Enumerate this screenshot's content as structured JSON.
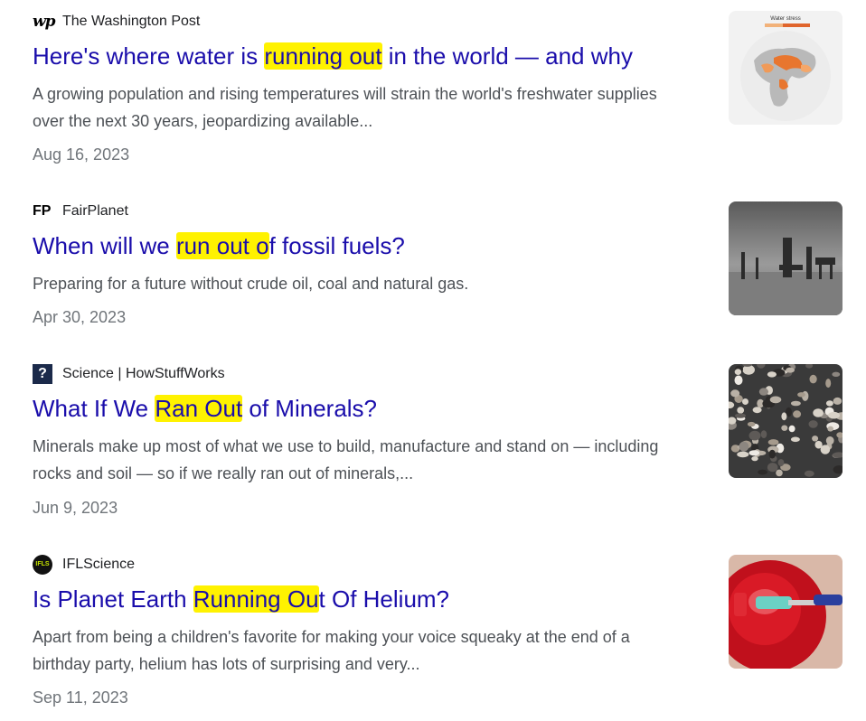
{
  "results": [
    {
      "source": "The Washington Post",
      "icon": "wp-logo-icon",
      "icon_text": "wp",
      "title_before": "Here's where water is ",
      "title_highlight": "running out",
      "title_after": " in the world — and why",
      "snippet_line1": "A growing population and rising temperatures will strain the world's freshwater supplies",
      "snippet_line2": "over the next 30 years, jeopardizing available...",
      "date": "Aug 16, 2023",
      "thumb": "water-stress-map-thumbnail",
      "thumb_label": "Water stress"
    },
    {
      "source": "FairPlanet",
      "icon": "fp-logo-icon",
      "icon_text": "FP",
      "title_before": "When will we ",
      "title_highlight": "run out o",
      "title_after": "f fossil fuels?",
      "snippet_line1": "Preparing for a future without crude oil, coal and natural gas.",
      "snippet_line2": "",
      "date": "Apr 30, 2023",
      "thumb": "oil-rigs-thumbnail"
    },
    {
      "source": "Science | HowStuffWorks",
      "icon": "howstuffworks-logo-icon",
      "icon_text": "?",
      "title_before": "What If We ",
      "title_highlight": "Ran Out",
      "title_after": " of Minerals?",
      "snippet_line1": "Minerals make up most of what we use to build, manufacture and stand on — including",
      "snippet_line2": "rocks and soil — so if we really ran out of minerals,...",
      "date": "Jun 9, 2023",
      "thumb": "pebbles-thumbnail"
    },
    {
      "source": "IFLScience",
      "icon": "iflscience-logo-icon",
      "icon_text": "IFLS",
      "title_before": "Is Planet Earth ",
      "title_highlight": "Running Ou",
      "title_after": "t Of Helium?",
      "snippet_line1": "Apart from being a children's favorite for making your voice squeaky at the end of a",
      "snippet_line2": "birthday party, helium has lots of surprising and very...",
      "date": "Sep 11, 2023",
      "thumb": "helium-tank-thumbnail"
    }
  ],
  "colors": {
    "title_link": "#1a0dab",
    "highlight": "#fff200",
    "snippet": "#4d5156",
    "date": "#70757a"
  }
}
